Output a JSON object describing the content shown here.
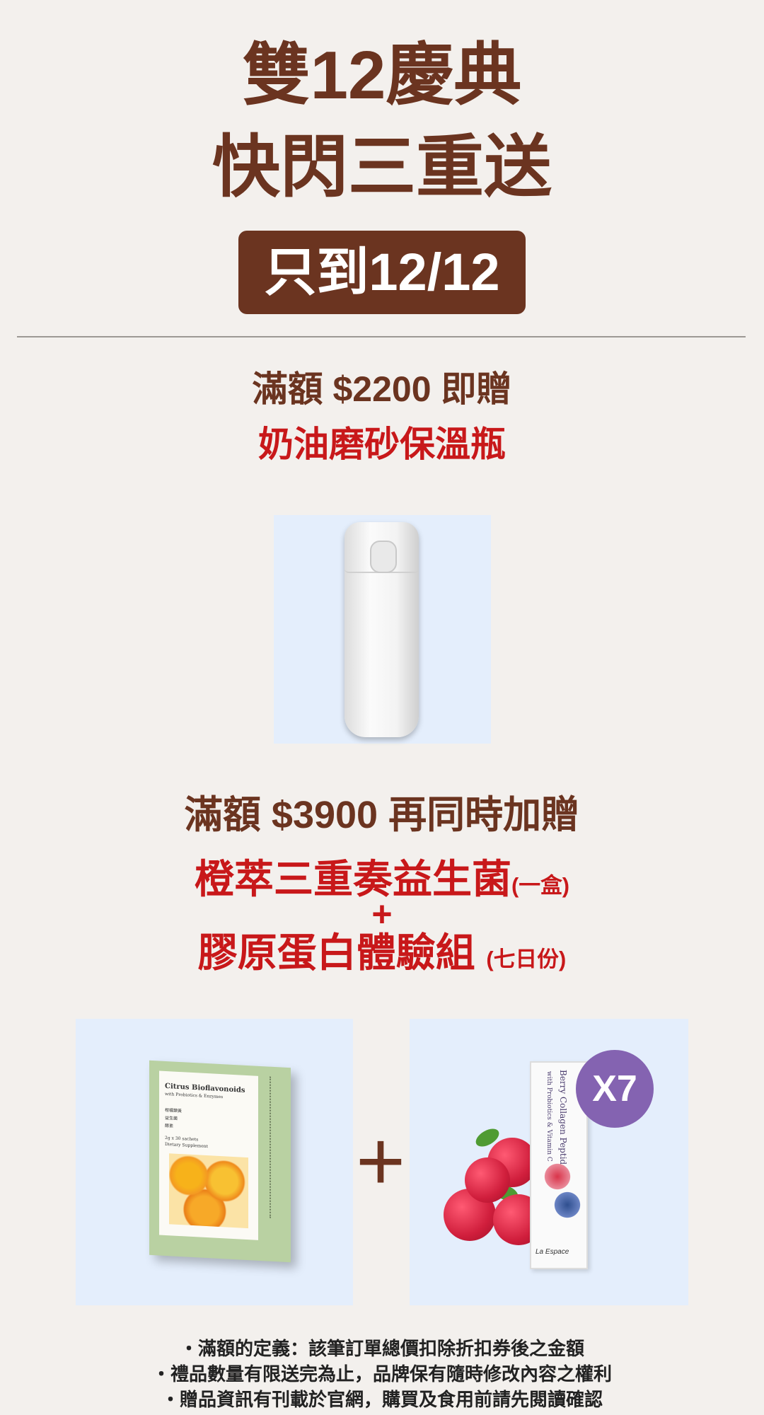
{
  "header": {
    "title_line1": "雙12慶典",
    "title_line2": "快閃三重送",
    "deadline": "只到12/12"
  },
  "tier1": {
    "condition": "滿額 $2200 即贈",
    "gift": "奶油磨砂保溫瓶"
  },
  "tier2": {
    "condition": "滿額 $3900  再同時加贈",
    "gift1": "橙萃三重奏益生菌",
    "gift1_qty": "(一盒)",
    "plus": "+",
    "gift2": "膠原蛋白體驗組",
    "gift2_qty": "(七日份)"
  },
  "products": {
    "box": {
      "name": "Citrus Bioflavonoids",
      "sub": "with Probiotics & Enzymes",
      "cn1": "柑橘類黃",
      "cn2": "益生菌",
      "cn3": "酵素",
      "count": "2g x 30 sachets",
      "type": "Dietary Supplement"
    },
    "plus_sign": "+",
    "stick": {
      "name": "Berry Collagen Peptides",
      "sub": "with Probiotics & Vitamin C",
      "brand": "La Espace"
    },
    "badge": "X7"
  },
  "notes": [
    "・滿額的定義：該筆訂單總價扣除折扣券後之金額",
    "・禮品數量有限送完為止，品牌保有隨時修改內容之權利",
    "・贈品資訊有刊載於官網，購買及食用前請先閱讀確認"
  ],
  "colors": {
    "background": "#f3f0ed",
    "brown": "#6b3420",
    "red": "#c8181a",
    "card": "#e4eefc",
    "badge": "#8463b1"
  }
}
